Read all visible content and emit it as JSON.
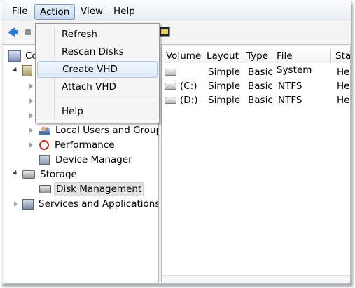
{
  "menubar": {
    "file": "File",
    "action": "Action",
    "view": "View",
    "help": "Help"
  },
  "action_menu": {
    "refresh": "Refresh",
    "rescan": "Rescan Disks",
    "create_vhd": "Create VHD",
    "attach_vhd": "Attach VHD",
    "help": "Help"
  },
  "tree": {
    "root_partial": "Co",
    "local_users": "Local Users and Groups",
    "performance": "Performance",
    "device_manager": "Device Manager",
    "storage": "Storage",
    "disk_management": "Disk Management",
    "services": "Services and Applications"
  },
  "list": {
    "columns": [
      "Volume",
      "Layout",
      "Type",
      "File System",
      "Stat"
    ],
    "rows": [
      {
        "volume": "",
        "layout": "Simple",
        "type": "Basic",
        "fs": "",
        "status": "Hea"
      },
      {
        "volume": "(C:)",
        "layout": "Simple",
        "type": "Basic",
        "fs": "NTFS",
        "status": "Hea"
      },
      {
        "volume": "(D:)",
        "layout": "Simple",
        "type": "Basic",
        "fs": "NTFS",
        "status": "Hea"
      }
    ]
  },
  "colors": {
    "menu_highlight": "#c4d8f0",
    "selection": "#e2e2e2",
    "back_arrow": "#2f7bd6"
  }
}
